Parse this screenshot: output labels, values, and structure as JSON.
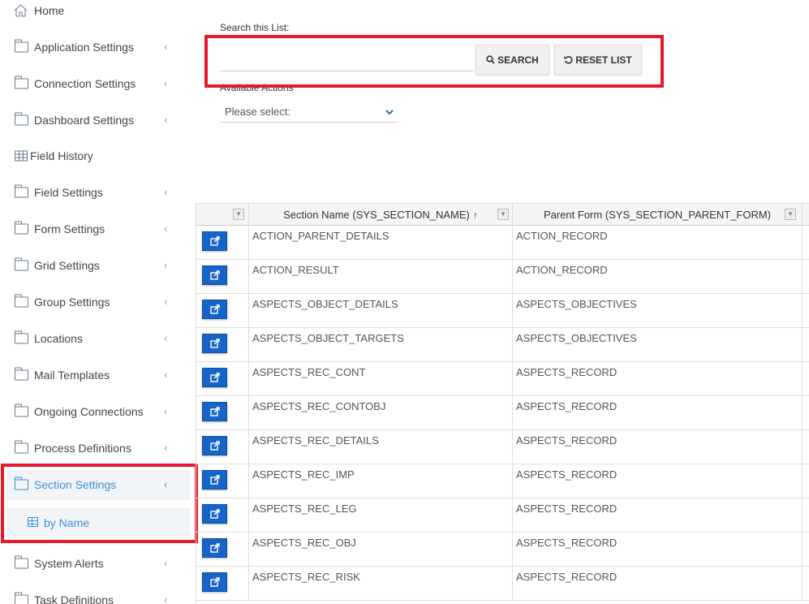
{
  "sidebar": {
    "home": "Home",
    "items": [
      {
        "label": "Application Settings"
      },
      {
        "label": "Connection Settings"
      },
      {
        "label": "Dashboard Settings"
      },
      {
        "label": "Field History"
      },
      {
        "label": "Field Settings"
      },
      {
        "label": "Form Settings"
      },
      {
        "label": "Grid Settings"
      },
      {
        "label": "Group Settings"
      },
      {
        "label": "Locations"
      },
      {
        "label": "Mail Templates"
      },
      {
        "label": "Ongoing Connections"
      },
      {
        "label": "Process Definitions"
      },
      {
        "label": "Section Settings"
      },
      {
        "label": "System Alerts"
      },
      {
        "label": "Task Definitions"
      }
    ],
    "sub_item": "by Name"
  },
  "search": {
    "label": "Search this List:",
    "value": "",
    "search_button": "SEARCH",
    "reset_button": "RESET LIST"
  },
  "actions": {
    "label": "Available Actions",
    "selected": "Please select:"
  },
  "grid": {
    "columns": [
      "Section Name (SYS_SECTION_NAME)",
      "Parent Form (SYS_SECTION_PARENT_FORM)"
    ],
    "sort_indicator": "↑",
    "rows": [
      [
        "ACTION_PARENT_DETAILS",
        "ACTION_RECORD"
      ],
      [
        "ACTION_RESULT",
        "ACTION_RECORD"
      ],
      [
        "ASPECTS_OBJECT_DETAILS",
        "ASPECTS_OBJECTIVES"
      ],
      [
        "ASPECTS_OBJECT_TARGETS",
        "ASPECTS_OBJECTIVES"
      ],
      [
        "ASPECTS_REC_CONT",
        "ASPECTS_RECORD"
      ],
      [
        "ASPECTS_REC_CONTOBJ",
        "ASPECTS_RECORD"
      ],
      [
        "ASPECTS_REC_DETAILS",
        "ASPECTS_RECORD"
      ],
      [
        "ASPECTS_REC_IMP",
        "ASPECTS_RECORD"
      ],
      [
        "ASPECTS_REC_LEG",
        "ASPECTS_RECORD"
      ],
      [
        "ASPECTS_REC_OBJ",
        "ASPECTS_RECORD"
      ],
      [
        "ASPECTS_REC_RISK",
        "ASPECTS_RECORD"
      ]
    ]
  },
  "colors": {
    "accent": "#3a8fd4",
    "highlight_box": "#e8192c",
    "edit_button": "#1664c8"
  }
}
